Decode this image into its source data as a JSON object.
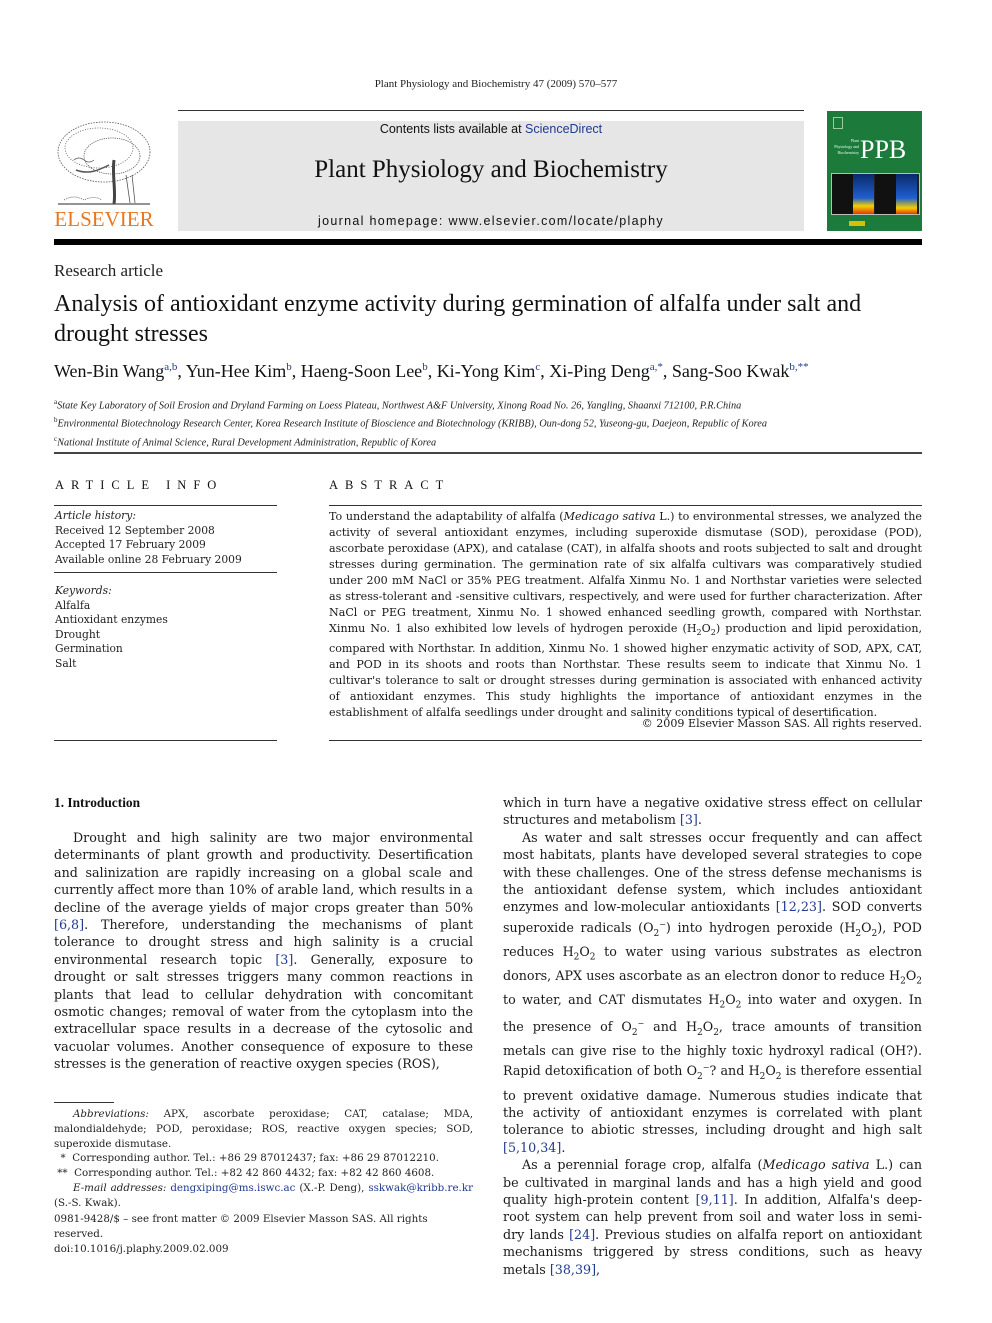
{
  "header": {
    "running_head": "Plant Physiology and Biochemistry 47 (2009) 570–577",
    "contents_prefix": "Contents lists available at ",
    "contents_link": "ScienceDirect",
    "journal_title": "Plant Physiology and Biochemistry",
    "homepage": "journal homepage: www.elsevier.com/locate/plaphy",
    "publisher_wordmark": "ELSEVIER",
    "cover_abbrev": "PPB",
    "cover_subtitle": "Plant Physiology and Biochemistry",
    "colors": {
      "elsevier_orange": "#e87722",
      "cover_green": "#1c7a3a",
      "masthead_gray": "#e6e6e6",
      "link_blue": "#1f3a8f"
    }
  },
  "article": {
    "type": "Research article",
    "title": "Analysis of antioxidant enzyme activity during germination of alfalfa under salt and drought stresses",
    "authors": [
      {
        "name": "Wen-Bin Wang",
        "sup": "a,b",
        "sep": ", "
      },
      {
        "name": "Yun-Hee Kim",
        "sup": "b",
        "sep": ", "
      },
      {
        "name": "Haeng-Soon Lee",
        "sup": "b",
        "sep": ", "
      },
      {
        "name": "Ki-Yong Kim",
        "sup": "c",
        "sep": ", "
      },
      {
        "name": "Xi-Ping Deng",
        "sup": "a,*",
        "sep": ", "
      },
      {
        "name": "Sang-Soo Kwak",
        "sup": "b,**",
        "sep": ""
      }
    ],
    "affiliations": [
      {
        "mark": "a",
        "text": "State Key Laboratory of Soil Erosion and Dryland Farming on Loess Plateau, Northwest A&F University, Xinong Road No. 26, Yangling, Shaanxi 712100, P.R.China"
      },
      {
        "mark": "b",
        "text": "Environmental Biotechnology Research Center, Korea Research Institute of Bioscience and Biotechnology (KRIBB), Oun-dong 52, Yuseong-gu, Daejeon, Republic of Korea"
      },
      {
        "mark": "c",
        "text": "National Institute of Animal Science, Rural Development Administration, Republic of Korea"
      }
    ]
  },
  "article_info": {
    "heading": "ARTICLE INFO",
    "history_label": "Article history:",
    "history": [
      "Received 12 September 2008",
      "Accepted 17 February 2009",
      "Available online 28 February 2009"
    ],
    "keywords_label": "Keywords:",
    "keywords": [
      "Alfalfa",
      "Antioxidant enzymes",
      "Drought",
      "Germination",
      "Salt"
    ]
  },
  "abstract": {
    "heading": "ABSTRACT",
    "t1": "To understand the adaptability of alfalfa (",
    "t1_it": "Medicago sativa",
    "t2": " L.) to environmental stresses, we analyzed the activity of several antioxidant enzymes, including superoxide dismutase (SOD), peroxidase (POD), ascorbate peroxidase (APX), and catalase (CAT), in alfalfa shoots and roots subjected to salt and drought stresses during germination. The germination rate of six alfalfa cultivars was comparatively studied under 200 mM NaCl or 35% PEG treatment. Alfalfa Xinmu No. 1 and Northstar varieties were selected as stress-tolerant and -sensitive cultivars, respectively, and were used for further characterization. After NaCl or PEG treatment, Xinmu No. 1 showed enhanced seedling growth, compared with Northstar. Xinmu No. 1 also exhibited low levels of hydrogen peroxide (H",
    "t3": "O",
    "t4": ") production and lipid peroxidation, compared with Northstar. In addition, Xinmu No. 1 showed higher enzymatic activity of SOD, APX, CAT, and POD in its shoots and roots than Northstar. These results seem to indicate that Xinmu No. 1 cultivar's tolerance to salt or drought stresses during germination is associated with enhanced activity of antioxidant enzymes. This study highlights the importance of antioxidant enzymes in the establishment of alfalfa seedlings under drought and salinity conditions typical of desertification.",
    "sub2": "2",
    "copyright": "© 2009 Elsevier Masson SAS. All rights reserved."
  },
  "intro": {
    "heading": "1.  Introduction",
    "p1a": "Drought and high salinity are two major environmental determinants of plant growth and productivity. Desertification and salinization are rapidly increasing on a global scale and currently affect more than 10% of arable land, which results in a decline of the average yields of major crops greater than 50% ",
    "ref1": "[6,8]",
    "p1b": ". Therefore, understanding the mechanisms of plant tolerance to drought stress and high salinity is a crucial environmental research topic ",
    "ref2": "[3]",
    "p1c": ". Generally, exposure to drought or salt stresses triggers many common reactions in plants that lead to cellular dehydration with concomitant osmotic changes; removal of water from the cytoplasm into the extracellular space results in a decrease of the cytosolic and vacuolar volumes. Another consequence of exposure to these stresses is the generation of reactive oxygen species (ROS), which in turn have a negative oxidative stress effect on cellular structures and metabolism ",
    "ref3": "[3]",
    "p1d": ".",
    "p2a": "As water and salt stresses occur frequently and can affect most habitats, plants have developed several strategies to cope with these challenges. One of the stress defense mechanisms is the antioxidant defense system, which includes antioxidant enzymes and low-molecular antioxidants ",
    "ref4": "[12,23]",
    "p2b": ". SOD converts superoxide radicals (O",
    "p2c": ") into hydrogen peroxide (H",
    "p2d": "), POD reduces H",
    "p2e": " to water using various substrates as electron donors, APX uses ascorbate as an electron donor to reduce H",
    "p2f": " to water, and CAT dismutates H",
    "p2g": " into water and oxygen. In the presence of O",
    "p2h": " and H",
    "p2i": ", trace amounts of transition metals can give rise to the highly toxic hydroxyl radical (OH?). Rapid detoxification of both O",
    "p2j": "? and H",
    "p2k": " is therefore essential to prevent oxidative damage. Numerous studies indicate that the activity of antioxidant enzymes is correlated with plant tolerance to abiotic stresses, including drought and high salt ",
    "ref5": "[5,10,34]",
    "p2l": ".",
    "p3a": "As a perennial forage crop, alfalfa (",
    "p3_it": "Medicago sativa",
    "p3b": " L.) can be cultivated in marginal lands and has a high yield and good quality high-protein content ",
    "ref6": "[9,11]",
    "p3c": ". In addition, Alfalfa's deep-root system can help prevent from soil and water loss in semi-dry lands ",
    "ref7": "[24]",
    "p3d": ". Previous studies on alfalfa report on antioxidant mechanisms triggered by stress conditions, such as heavy metals ",
    "ref8": "[38,39]",
    "p3e": ",",
    "h": "H",
    "o": "O",
    "two": "2",
    "minus": "−"
  },
  "footnotes": {
    "abbr_label": "Abbreviations:",
    "abbr_text": " APX, ascorbate peroxidase; CAT, catalase; MDA, malondialdehyde; POD, peroxidase; ROS, reactive oxygen species; SOD, superoxide dismutase.",
    "corr1_mark": "*",
    "corr1": "Corresponding author. Tel.: +86 29 87012437; fax: +86 29 87012210.",
    "corr2_mark": "**",
    "corr2": "Corresponding author. Tel.: +82 42 860 4432; fax: +82 42 860 4608.",
    "email_label": "E-mail addresses:",
    "email1": "dengxiping@ms.iswc.ac",
    "email1_owner": " (X.-P. Deng), ",
    "email2": "sskwak@kribb.re.kr",
    "email2_owner": " (S.-S. Kwak).",
    "issn": "0981-9428/$ – see front matter © 2009 Elsevier Masson SAS. All rights reserved.",
    "doi": "doi:10.1016/j.plaphy.2009.02.009"
  }
}
